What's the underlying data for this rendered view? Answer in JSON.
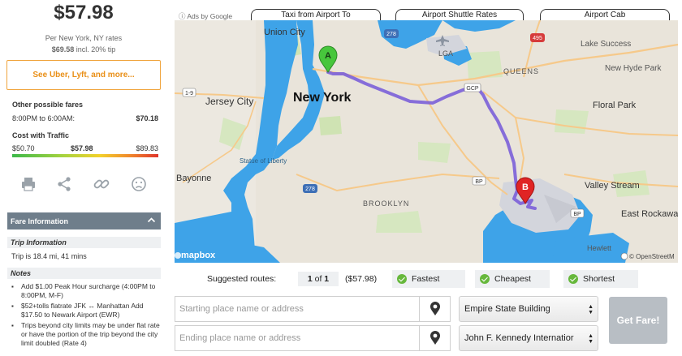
{
  "summary": {
    "price": "$57.98",
    "rates_line": "Per New York, NY rates",
    "tip_amount": "$69.58",
    "tip_suffix": "incl. 20% tip",
    "see_more_label": "See Uber, Lyft, and more..."
  },
  "other_fares": {
    "title": "Other possible fares",
    "row_label": "8:00PM to 6:00AM:",
    "row_amount": "$70.18"
  },
  "traffic": {
    "title": "Cost with Traffic",
    "low": "$50.70",
    "mid": "$57.98",
    "high": "$89.83"
  },
  "actions": {
    "icons": [
      "printer-icon",
      "share-icon",
      "link-icon",
      "frown-icon"
    ]
  },
  "fare_info": {
    "header": "Fare Information",
    "trip_header": "Trip Information",
    "trip_text": "Trip is 18.4 mi, 41 mins",
    "notes_header": "Notes",
    "notes": [
      "Add $1.00 Peak Hour surcharge (4:00PM to 8:00PM, M-F)",
      "$52+tolls flatrate JFK ↔ Manhattan Add $17.50 to Newark Airport (EWR)",
      "Trips beyond city limits may be under flat rate or have the portion of the trip beyond the city limit doubled (Rate 4)"
    ]
  },
  "map_tabs": {
    "ads": "ⓘ Ads by Google",
    "tab1": "Taxi from Airport To",
    "tab2": "Airport Shuttle Rates",
    "tab3": "Airport Cab"
  },
  "map": {
    "labels": {
      "union_city": "Union City",
      "jersey_city": "Jersey City",
      "new_york": "New York",
      "statue": "Statue of Liberty",
      "bayonne": "Bayonne",
      "brooklyn": "BROOKLYN",
      "queens": "QUEENS",
      "lga": "LGA",
      "lake_success": "Lake Success",
      "new_hyde_park": "New Hyde Park",
      "floral_park": "Floral Park",
      "valley_stream": "Valley Stream",
      "east_rockaway": "East Rockawa",
      "hewlett": "Hewlett",
      "mapbox": "mapbox",
      "osm": "© OpenStreetM"
    },
    "shields": {
      "i278a": "278",
      "i278b": "278",
      "i495": "495",
      "gcp": "GCP",
      "bp": "BP",
      "bp2": "BP",
      "r19": "1-9"
    },
    "marker_a": "A",
    "marker_b": "B",
    "route_color": "#7b5fd8",
    "water_color": "#3ea3e8"
  },
  "routes": {
    "label": "Suggested routes:",
    "current": "1",
    "of_word": "of",
    "total": "1",
    "price": "($57.98)",
    "options": [
      "Fastest",
      "Cheapest",
      "Shortest"
    ]
  },
  "form": {
    "start_placeholder": "Starting place name or address",
    "end_placeholder": "Ending place name or address",
    "start_select": "Empire State Building",
    "end_select": "John F. Kennedy Internatior",
    "get_fare": "Get Fare!"
  }
}
